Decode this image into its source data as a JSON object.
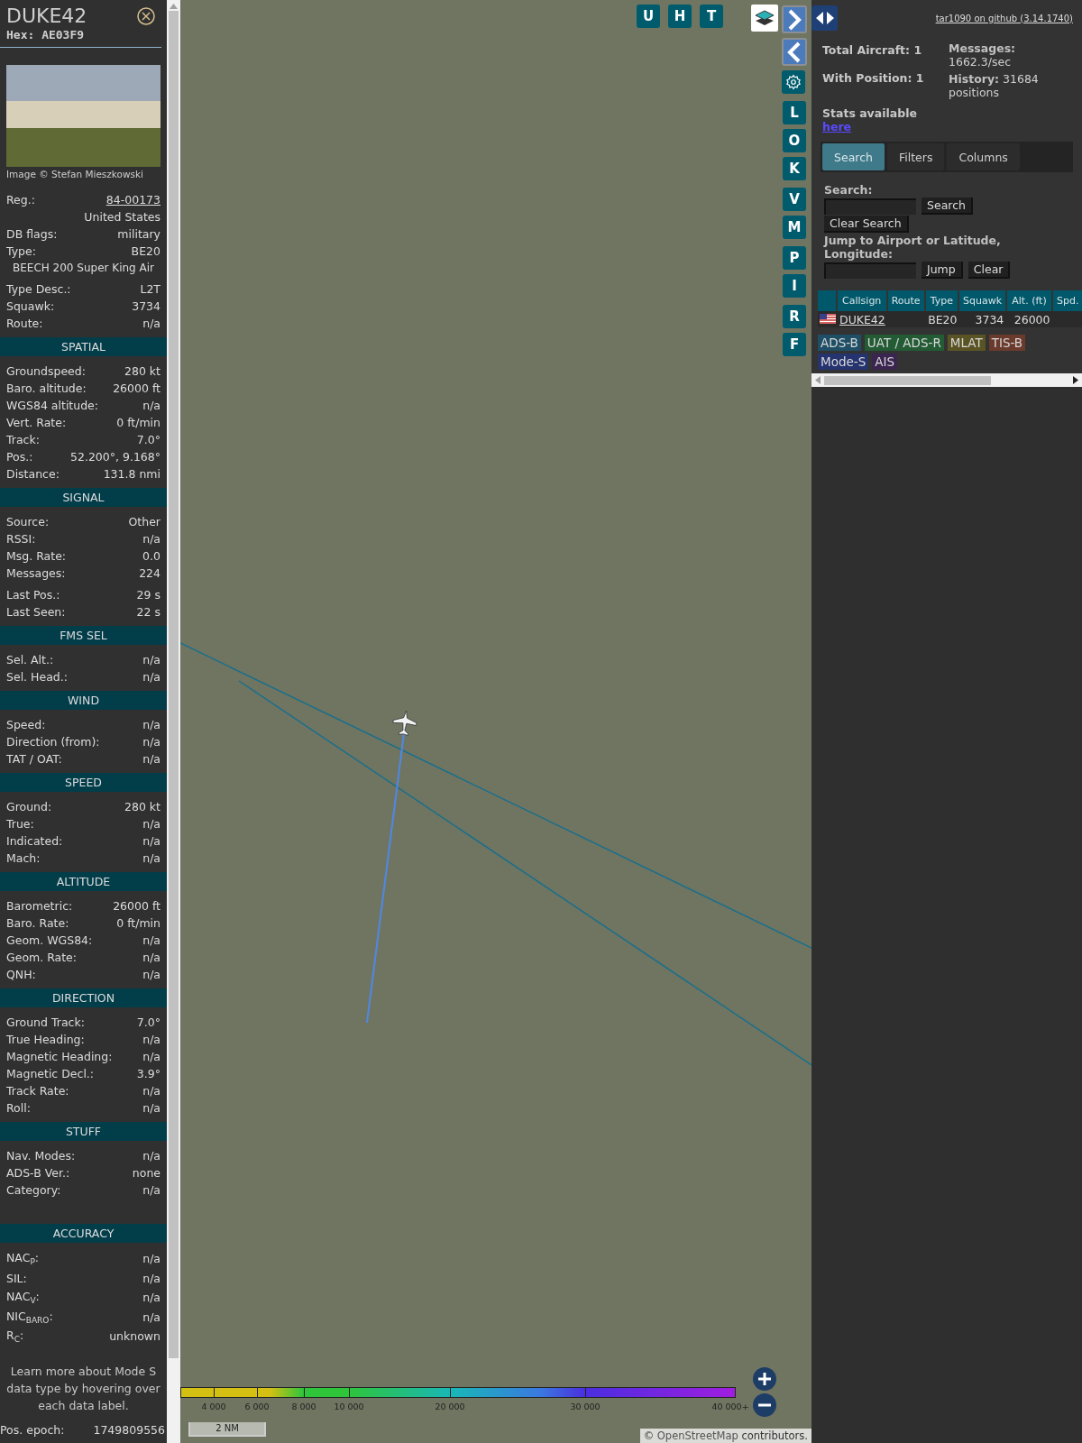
{
  "aircraft": {
    "callsign": "DUKE42",
    "hex": "Hex: AE03F9"
  },
  "photo": {
    "credit": "Image © Stefan Mieszkowski"
  },
  "details": [
    {
      "kind": "link",
      "label": "Reg.:",
      "value": "84-00173"
    },
    {
      "kind": "value",
      "value": "United States"
    },
    {
      "kind": "pair",
      "label": "DB flags:",
      "value": "military"
    },
    {
      "kind": "pair",
      "label": "Type:",
      "value": "BE20"
    },
    {
      "kind": "wide",
      "value": "BEECH 200 Super King Air"
    },
    {
      "kind": "pair",
      "label": "Type Desc.:",
      "value": "L2T"
    },
    {
      "kind": "pair",
      "label": "Squawk:",
      "value": "3734"
    },
    {
      "kind": "pair",
      "label": "Route:",
      "value": "n/a"
    }
  ],
  "sections": [
    {
      "title": "SPATIAL",
      "groups": [
        [
          {
            "label": "Groundspeed:",
            "value": "280 kt"
          },
          {
            "label": "Baro. altitude:",
            "value": "26000 ft"
          },
          {
            "label": "WGS84 altitude:",
            "value": "n/a"
          },
          {
            "label": "Vert. Rate:",
            "value": "0 ft/min"
          },
          {
            "label": "Track:",
            "value": "7.0°"
          },
          {
            "label": "Pos.:",
            "value": "52.200°, 9.168°"
          },
          {
            "label": "Distance:",
            "value": "131.8 nmi"
          }
        ]
      ]
    },
    {
      "title": "SIGNAL",
      "groups": [
        [
          {
            "label": "Source:",
            "value": "Other"
          },
          {
            "label": "RSSI:",
            "value": "n/a"
          },
          {
            "label": "Msg. Rate:",
            "value": "0.0"
          },
          {
            "label": "Messages:",
            "value": "224"
          }
        ],
        [
          {
            "label": "Last Pos.:",
            "value": "29 s"
          },
          {
            "label": "Last Seen:",
            "value": "22 s"
          }
        ]
      ]
    },
    {
      "title": "FMS SEL",
      "groups": [
        [
          {
            "label": "Sel. Alt.:",
            "value": "n/a"
          },
          {
            "label": "Sel. Head.:",
            "value": "n/a"
          }
        ]
      ]
    },
    {
      "title": "WIND",
      "groups": [
        [
          {
            "label": "Speed:",
            "value": "n/a"
          },
          {
            "label": "Direction (from):",
            "value": "n/a"
          },
          {
            "label": "TAT / OAT:",
            "value": "n/a"
          }
        ]
      ]
    },
    {
      "title": "SPEED",
      "groups": [
        [
          {
            "label": "Ground:",
            "value": "280 kt"
          },
          {
            "label": "True:",
            "value": "n/a"
          },
          {
            "label": "Indicated:",
            "value": "n/a"
          },
          {
            "label": "Mach:",
            "value": "n/a"
          }
        ]
      ]
    },
    {
      "title": "ALTITUDE",
      "groups": [
        [
          {
            "label": "Barometric:",
            "value": "26000 ft"
          },
          {
            "label": "Baro. Rate:",
            "value": "0 ft/min"
          },
          {
            "label": "Geom. WGS84:",
            "value": "n/a"
          },
          {
            "label": "Geom. Rate:",
            "value": "n/a"
          },
          {
            "label": "QNH:",
            "value": "n/a"
          }
        ]
      ]
    },
    {
      "title": "DIRECTION",
      "groups": [
        [
          {
            "label": "Ground Track:",
            "value": "7.0°"
          },
          {
            "label": "True Heading:",
            "value": "n/a"
          },
          {
            "label": "Magnetic Heading:",
            "value": "n/a"
          },
          {
            "label": "Magnetic Decl.:",
            "value": "3.9°"
          },
          {
            "label": "Track Rate:",
            "value": "n/a"
          },
          {
            "label": "Roll:",
            "value": "n/a"
          }
        ]
      ]
    },
    {
      "title": "STUFF",
      "groups": [
        [
          {
            "label": "Nav. Modes:",
            "value": "n/a"
          },
          {
            "label": "ADS-B Ver.:",
            "value": "none"
          },
          {
            "label": "Category:",
            "value": "n/a"
          }
        ]
      ]
    },
    {
      "title": "ACCURACY",
      "groups": [
        [
          {
            "label": "NAC$_{P}$:",
            "value": "n/a"
          },
          {
            "label": "SIL:",
            "value": "n/a"
          },
          {
            "label": "NAC$_{V}$:",
            "value": "n/a"
          },
          {
            "label": "NIC$_{BARO}$:",
            "value": "n/a"
          },
          {
            "label": "R$_{C}$:",
            "value": "unknown"
          }
        ]
      ]
    }
  ],
  "note": "Learn more about Mode S data type by hovering over each data label.",
  "epoch": {
    "label": "Pos. epoch:",
    "value": "1749809556"
  },
  "map": {
    "top_buttons": [
      "U",
      "H",
      "T"
    ],
    "side_groups": [
      [
        "L",
        "O",
        "K"
      ],
      [
        "V",
        "M"
      ],
      [
        "P",
        "I"
      ],
      [
        "R",
        "F"
      ]
    ],
    "altitude_scale": [
      "4 000",
      "6 000",
      "8 000",
      "10 000",
      "20 000",
      "30 000",
      "40 000+"
    ],
    "distance_scale": "2 NM",
    "attribution": {
      "prefix": "©",
      "link": "OpenStreetMap",
      "suffix": "contributors."
    }
  },
  "panel": {
    "github_link": "tar1090 on github (3.14.1740)",
    "stats_left": [
      "Total Aircraft: 1",
      "With Position: 1"
    ],
    "stats_right": [
      "**Messages:** 1662.3/sec",
      "**History:** 31684 positions"
    ],
    "stats_note": {
      "text": "Stats available",
      "link": "here"
    },
    "tabs": [
      {
        "label": "Search",
        "selected": true
      },
      {
        "label": "Filters",
        "selected": false
      },
      {
        "label": "Columns",
        "selected": false
      }
    ],
    "search": {
      "label": "Search:",
      "button": "Search",
      "clear_button": "Clear Search"
    },
    "jump": {
      "label": "Jump to Airport or Latitude, Longitude:",
      "button": "Jump",
      "clear_button": "Clear"
    },
    "table": {
      "columns": [
        "Callsign",
        "Route",
        "Type",
        "Squawk",
        "Alt. (ft)",
        "Spd."
      ],
      "rows": [
        [
          "DUKE42",
          null,
          "BE20",
          "3734",
          "26000",
          null
        ]
      ]
    },
    "legend": [
      {
        "label": "ADS-B",
        "color": "#1f4f66"
      },
      {
        "label": "UAT / ADS-R",
        "color": "#235c34"
      },
      {
        "label": "MLAT",
        "color": "#5a5424"
      },
      {
        "label": "TIS-B",
        "color": "#6a3a2c"
      },
      {
        "label": "Mode-S",
        "color": "#25336f"
      },
      {
        "label": "AIS",
        "color": "#3a2450"
      }
    ]
  }
}
